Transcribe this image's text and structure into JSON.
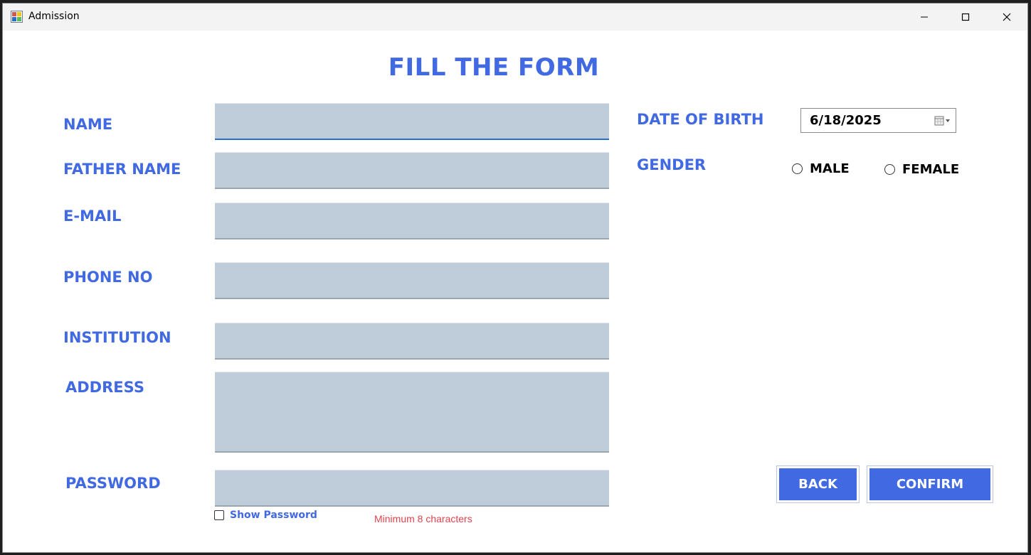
{
  "window": {
    "title": "Admission",
    "icon": "form-app-icon"
  },
  "form": {
    "title": "FILL THE FORM",
    "labels": {
      "name": "NAME",
      "father_name": "FATHER NAME",
      "email": "E-MAIL",
      "phone": "PHONE NO",
      "institution": "INSTITUTION",
      "address": "ADDRESS",
      "password": "PASSWORD",
      "dob": "DATE OF BIRTH",
      "gender": "GENDER"
    },
    "values": {
      "name": "",
      "father_name": "",
      "email": "",
      "phone": "",
      "institution": "",
      "address": "",
      "password": ""
    },
    "show_password_label": "Show Password",
    "show_password_checked": false,
    "password_hint": "Minimum 8 characters",
    "dob_value": "6/18/2025",
    "gender_options": [
      "MALE",
      "FEMALE"
    ],
    "gender_selected": null
  },
  "buttons": {
    "back": "BACK",
    "confirm": "CONFIRM"
  },
  "colors": {
    "accent": "#4169e1",
    "field_bg": "#bfcdda",
    "hint": "#e0434e",
    "focus": "#2b6fc4"
  }
}
